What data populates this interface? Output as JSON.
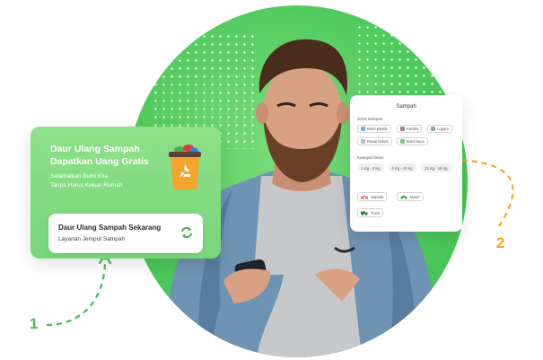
{
  "left_card": {
    "title": "Daur Ulang Sampah Dapatkan Uang Gratis",
    "subtitle_line1": "Selamatkan Bumi Kita",
    "subtitle_line2": "Tanpa Harus Keluar Rumah",
    "button_title": "Daur Ulang Sampah Sekarang",
    "button_subtitle": "Layanan Jemput Sampah",
    "bin_icon": "recycle-bin-icon",
    "action_icon": "recycle-arrows-icon"
  },
  "right_card": {
    "title": "Sampah",
    "waste_type_label": "Jenis sampah",
    "waste_types": [
      "Botol plastik",
      "Kardus",
      "Logam",
      "Kaleng",
      "Botol kaca",
      "Rotan bekas"
    ],
    "weight_label": "Kategori berat",
    "weights": [
      "1 Kg - 3 Kg",
      "4 Kg - 10 Kg",
      "11 Kg - 15 Kg"
    ],
    "vehicles": [
      "Sepeda",
      "Motor",
      "Truck"
    ]
  },
  "steps": {
    "one": "1",
    "two": "2"
  },
  "colors": {
    "brand_green": "#4fc95c",
    "accent_orange": "#f4a52c"
  }
}
